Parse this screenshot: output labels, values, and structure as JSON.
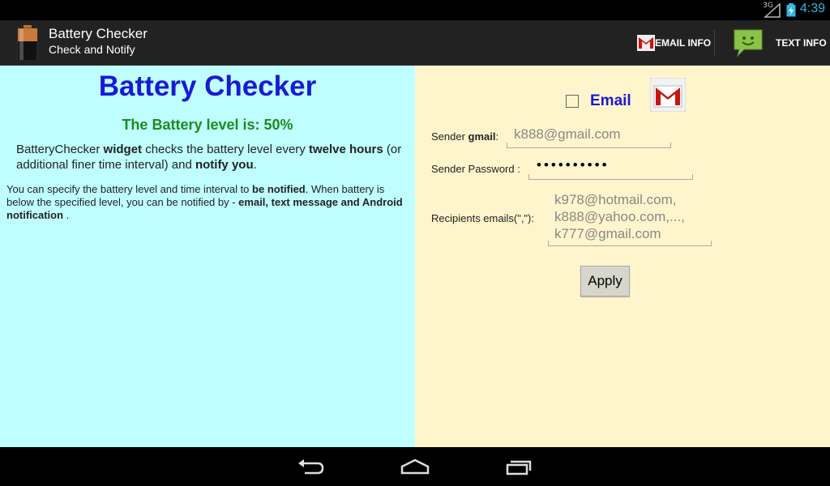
{
  "status": {
    "network": "3G",
    "time": "4:39"
  },
  "actionbar": {
    "title": "Battery Checker",
    "subtitle": "Check and Notify",
    "email_action": "EMAIL INFO",
    "text_action": "TEXT INFO"
  },
  "left": {
    "title": "Battery Checker",
    "level": "The Battery level is: 50%",
    "desc1_a": "BatteryChecker ",
    "desc1_b": "widget",
    "desc1_c": " checks the battery level every  ",
    "desc1_d": "twelve hours",
    "desc1_e": " (or additional finer time interval) and ",
    "desc1_f": "notify you",
    "desc1_g": ".",
    "desc2_a": " You can specify the battery level and time interval to ",
    "desc2_b": "be notified",
    "desc2_c": ". When battery is below the specified level, you can be notified by - ",
    "desc2_d": "email, text message and Android notification",
    "desc2_e": " ."
  },
  "right": {
    "email_label": "Email",
    "email_checked": false,
    "sender_label_a": "Sender ",
    "sender_label_b": "gmail",
    "sender_label_c": ":",
    "sender_value": "k888@gmail.com",
    "password_label": "Sender Password :",
    "password_value": "••••••••••",
    "recipients_label": "Recipients emails(\",\"):",
    "recipients_line1": "k978@hotmail.com,",
    "recipients_line2": "k888@yahoo.com,...,",
    "recipients_line3": "k777@gmail.com",
    "apply": "Apply"
  },
  "colors": {
    "left_bg": "#bfffff",
    "right_bg": "#fff5cc",
    "title": "#1a1ad4",
    "level": "#1c8c1c",
    "clock": "#33b5e5"
  }
}
